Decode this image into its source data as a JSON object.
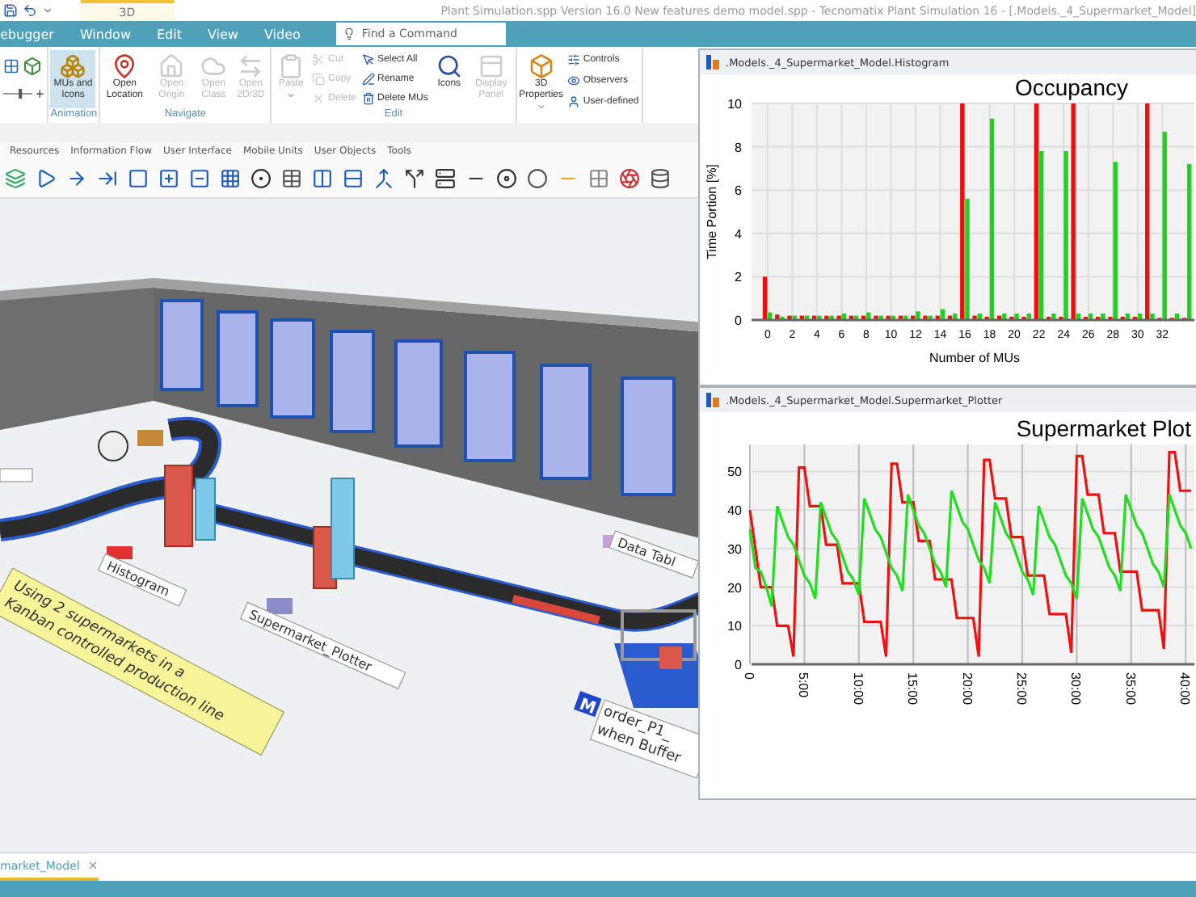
{
  "title_bar": {
    "context_tab": "3D",
    "title": "Plant Simulation.spp Version 16.0 New features demo model.spp - Tecnomatix Plant Simulation 16 - [.Models._4_Supermarket_Model]"
  },
  "menu": {
    "items": [
      {
        "label": "ebugger"
      },
      {
        "label": "Window"
      },
      {
        "label": "Edit"
      },
      {
        "label": "View"
      },
      {
        "label": "Video"
      }
    ],
    "search": {
      "placeholder": "Find a Command"
    }
  },
  "ribbon": {
    "groups": [
      {
        "items": [
          {
            "kind": "zoom",
            "label": "+",
            "level": 0.6
          }
        ]
      },
      {
        "label": "Animation",
        "items": [
          {
            "kind": "large",
            "label": "MUs and Icons",
            "selected": true,
            "disabled": false,
            "dropdown": false
          }
        ]
      },
      {
        "label": "Navigate",
        "items": [
          {
            "kind": "large",
            "label": "Open Location",
            "selected": false,
            "disabled": false,
            "dropdown": false
          },
          {
            "kind": "large",
            "label": "Open Origin",
            "selected": false,
            "disabled": true,
            "dropdown": false
          },
          {
            "kind": "large",
            "label": "Open Class",
            "selected": false,
            "disabled": true,
            "dropdown": false
          },
          {
            "kind": "large",
            "label": "Open 2D/3D",
            "selected": false,
            "disabled": true,
            "dropdown": false
          }
        ]
      },
      {
        "label": "Edit",
        "items": [
          {
            "kind": "large",
            "label": "Paste",
            "selected": false,
            "disabled": true,
            "dropdown": true
          },
          {
            "kind": "column",
            "items": [
              {
                "label": "Cut",
                "disabled": true
              },
              {
                "label": "Copy",
                "disabled": true
              },
              {
                "label": "Delete",
                "disabled": true
              }
            ]
          },
          {
            "kind": "column",
            "items": [
              {
                "label": "Select All",
                "disabled": false
              },
              {
                "label": "Rename",
                "disabled": false
              },
              {
                "label": "Delete MUs",
                "disabled": false
              }
            ]
          },
          {
            "kind": "large",
            "label": "Icons",
            "selected": false,
            "disabled": false,
            "dropdown": false
          },
          {
            "kind": "large",
            "label": "Display Panel",
            "selected": false,
            "disabled": true,
            "dropdown": false
          }
        ]
      },
      {
        "items": [
          {
            "kind": "large",
            "label": "3D Properties",
            "selected": false,
            "disabled": false,
            "dropdown": true
          },
          {
            "kind": "column",
            "items": [
              {
                "label": "Controls",
                "disabled": false
              },
              {
                "label": "Observers",
                "disabled": false
              },
              {
                "label": "User-defined",
                "disabled": false
              }
            ]
          }
        ]
      }
    ]
  },
  "library": {
    "tabs": [
      {
        "label": "Resources"
      },
      {
        "label": "Information Flow"
      },
      {
        "label": "User Interface"
      },
      {
        "label": "Mobile Units"
      },
      {
        "label": "User Objects"
      },
      {
        "label": "Tools"
      }
    ]
  },
  "scene": {
    "labels": [
      {
        "kind": "plate",
        "text": "Histogram"
      },
      {
        "kind": "plate",
        "text": "Supermarket_Plotter"
      },
      {
        "kind": "plate",
        "text": "Data Tabl"
      },
      {
        "kind": "note",
        "lines": [
          "Using 2 supermarkets in a",
          "Kanban controlled production line"
        ]
      },
      {
        "kind": "method",
        "icon_text": "M",
        "lines": [
          "order_P1_",
          "when Buffer"
        ]
      }
    ]
  },
  "histogram_window": {
    "title": ".Models._4_Supermarket_Model.Histogram",
    "chart_data": {
      "type": "bar",
      "title": "Occupancy",
      "xlabel": "Number of MUs",
      "ylabel": "Time Portion [%]",
      "grid": true,
      "x": [
        0,
        1,
        2,
        3,
        4,
        5,
        6,
        7,
        8,
        9,
        10,
        11,
        12,
        13,
        14,
        15,
        16,
        17,
        18,
        19,
        20,
        21,
        22,
        23,
        24,
        25,
        26,
        27,
        28,
        29,
        30,
        31,
        32,
        33,
        34
      ],
      "series": [
        {
          "color": "#e81010",
          "values": [
            2,
            0.25,
            0.2,
            0.2,
            0.2,
            0.2,
            0.2,
            0.2,
            0.2,
            0.2,
            0.2,
            0.2,
            0.2,
            0.2,
            0.2,
            0.2,
            10,
            0.2,
            0.15,
            0.2,
            0.15,
            0.15,
            10,
            0.15,
            0.15,
            10,
            0.15,
            0.15,
            0.15,
            0.15,
            0.15,
            10,
            0.1,
            0.1,
            0.1
          ]
        },
        {
          "color": "#22d022",
          "values": [
            0.35,
            0.15,
            0.2,
            0.2,
            0.2,
            0.2,
            0.3,
            0.2,
            0.35,
            0.2,
            0.2,
            0.2,
            0.4,
            0.2,
            0.5,
            0.3,
            5.6,
            0.3,
            9.3,
            0.3,
            0.3,
            0.3,
            7.8,
            0.3,
            7.8,
            0.3,
            0.3,
            0.3,
            7.3,
            0.3,
            0.3,
            0.3,
            8.7,
            0.3,
            7.2
          ]
        }
      ],
      "xlim": [
        -1.3,
        34.6
      ],
      "ylim": [
        0,
        10
      ],
      "yticks": [
        0,
        2,
        4,
        6,
        8,
        10
      ],
      "xticks": [
        0,
        2,
        4,
        6,
        8,
        10,
        12,
        14,
        16,
        18,
        20,
        22,
        24,
        26,
        28,
        30,
        32
      ]
    }
  },
  "plotter_window": {
    "title": ".Models._4_Supermarket_Model.Supermarket_Plotter",
    "chart_data": {
      "type": "line",
      "title": "Supermarket Plot",
      "grid": true,
      "x": [
        0,
        0.5,
        1,
        1.5,
        2,
        2.5,
        3,
        3.5,
        4,
        4.5,
        5,
        5.5,
        6,
        6.5,
        7,
        7.5,
        8,
        8.5,
        9,
        9.5,
        10,
        10.5,
        11,
        11.5,
        12,
        12.5,
        13,
        13.5,
        14,
        14.5,
        15,
        15.5,
        16,
        16.5,
        17,
        17.5,
        18,
        18.5,
        19,
        19.5,
        20,
        20.5,
        21,
        21.5,
        22,
        22.5,
        23,
        23.5,
        24,
        24.5,
        25,
        25.5,
        26,
        26.5,
        27,
        27.5,
        28,
        28.5,
        29,
        29.5,
        30,
        30.5,
        31,
        31.5,
        32,
        32.5,
        33,
        33.5,
        34,
        34.5,
        35,
        35.5,
        36,
        36.5,
        37,
        37.5,
        38,
        38.5,
        39,
        39.5,
        40,
        40.5
      ],
      "series": [
        {
          "color": "#ee1111",
          "values": [
            40,
            30,
            20,
            20,
            20,
            10,
            10,
            10,
            2,
            51,
            51,
            41,
            41,
            41,
            31,
            31,
            31,
            21,
            21,
            21,
            21,
            11,
            11,
            11,
            11,
            2,
            52,
            52,
            42,
            42,
            42,
            32,
            32,
            32,
            22,
            22,
            22,
            22,
            12,
            12,
            12,
            12,
            2,
            53,
            53,
            43,
            43,
            43,
            33,
            33,
            33,
            23,
            23,
            23,
            23,
            13,
            13,
            13,
            13,
            3,
            54,
            54,
            44,
            44,
            44,
            34,
            34,
            34,
            24,
            24,
            24,
            24,
            14,
            14,
            14,
            14,
            4,
            55,
            55,
            45,
            45,
            45
          ]
        },
        {
          "color": "#22dd22",
          "values": [
            35,
            25,
            24,
            20,
            15,
            41,
            37,
            33,
            31,
            27,
            23,
            21,
            17,
            42,
            38,
            34,
            32,
            28,
            24,
            22,
            18,
            43,
            39,
            35,
            33,
            29,
            25,
            23,
            19,
            44,
            40,
            36,
            34,
            30,
            26,
            24,
            20,
            45,
            41,
            37,
            35,
            31,
            27,
            25,
            21,
            42,
            38,
            34,
            32,
            28,
            24,
            22,
            18,
            41,
            37,
            33,
            31,
            27,
            23,
            21,
            17,
            43,
            39,
            35,
            33,
            29,
            25,
            23,
            19,
            44,
            40,
            36,
            34,
            30,
            26,
            24,
            20,
            44,
            40,
            36,
            34,
            30
          ]
        }
      ],
      "xlim": [
        0,
        40.5
      ],
      "ylim": [
        0,
        57
      ],
      "yticks": [
        0,
        10,
        20,
        30,
        40,
        50
      ],
      "xticks": [
        {
          "value": 0,
          "label": "0"
        },
        {
          "value": 5,
          "label": "5:00"
        },
        {
          "value": 10,
          "label": "10:00"
        },
        {
          "value": 15,
          "label": "15:00"
        },
        {
          "value": 20,
          "label": "20:00"
        },
        {
          "value": 25,
          "label": "25:00"
        },
        {
          "value": 30,
          "label": "30:00"
        },
        {
          "value": 35,
          "label": "35:00"
        },
        {
          "value": 40,
          "label": "40:00"
        }
      ]
    }
  },
  "document_tab": {
    "label": "market_Model",
    "selected": true
  }
}
